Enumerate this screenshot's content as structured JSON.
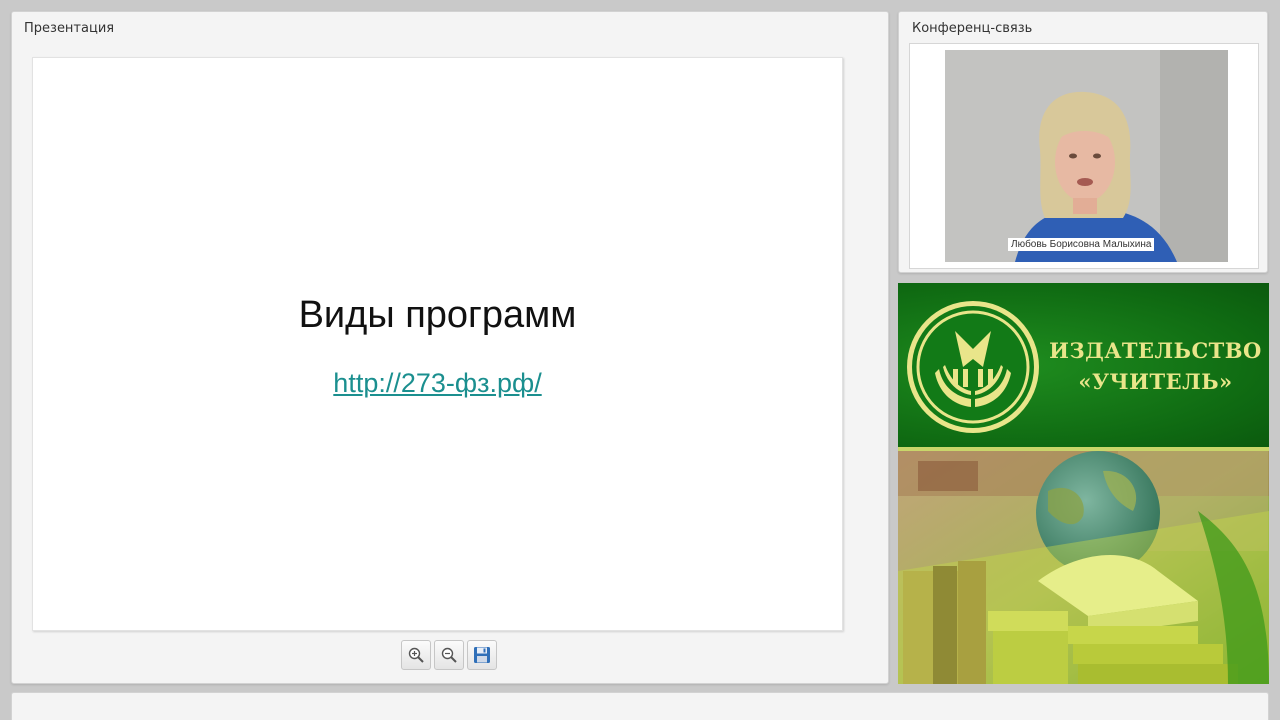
{
  "presentation": {
    "title": "Презентация",
    "slide": {
      "heading": "Виды программ",
      "link": "http://273-фз.рф/"
    },
    "toolbar": {
      "zoom_in": "zoom-in-icon",
      "zoom_out": "zoom-out-icon",
      "save": "save-icon"
    }
  },
  "conference": {
    "title": "Конференц-связь",
    "participant_name": "Любовь Борисовна Малыхина"
  },
  "banner": {
    "publisher_line1": "ИЗДАТЕЛЬСТВО",
    "publisher_line2": "«УЧИТЕЛЬ»",
    "colors": {
      "green": "#0f6a12",
      "gold": "#e9e58a",
      "lime": "#b9d43a"
    }
  }
}
